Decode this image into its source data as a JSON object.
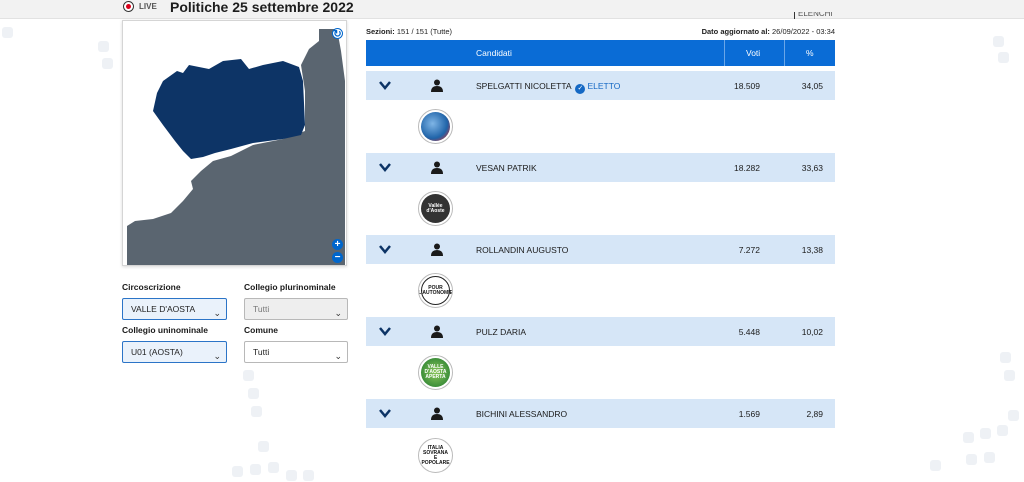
{
  "header": {
    "live_label": "LIVE",
    "title": "Politiche 25 settembre 2022",
    "partial_right_text": "ELENCHI"
  },
  "filters": {
    "circoscrizione": {
      "label": "Circoscrizione",
      "value": "VALLE D'AOSTA"
    },
    "collegio_plurinominale": {
      "label": "Collegio plurinominale",
      "value": "Tutti"
    },
    "collegio_uninominale": {
      "label": "Collegio uninominale",
      "value": "U01 (AOSTA)"
    },
    "comune": {
      "label": "Comune",
      "value": "Tutti"
    }
  },
  "meta": {
    "sezioni_label": "Sezioni:",
    "sezioni_value": "151 / 151 (Tutte)",
    "updated_label": "Dato aggiornato al:",
    "updated_value": "26/09/2022 - 03:34"
  },
  "table": {
    "headers": {
      "candidati": "Candidati",
      "voti": "Voti",
      "percent": "%"
    },
    "rows": [
      {
        "name": "SPELGATTI NICOLETTA",
        "elected": "ELETTO",
        "votes": "18.509",
        "pct": "34,05",
        "logo_color": "#1f63a8"
      },
      {
        "name": "VESAN PATRIK",
        "elected": "",
        "votes": "18.282",
        "pct": "33,63",
        "logo_color": "#333333"
      },
      {
        "name": "ROLLANDIN AUGUSTO",
        "elected": "",
        "votes": "7.272",
        "pct": "13,38",
        "logo_color": "#ffffff"
      },
      {
        "name": "PULZ DARIA",
        "elected": "",
        "votes": "5.448",
        "pct": "10,02",
        "logo_color": "#3d8f3a"
      },
      {
        "name": "BICHINI ALESSANDRO",
        "elected": "",
        "votes": "1.569",
        "pct": "2,89",
        "logo_color": "#ffffff"
      }
    ],
    "logo_texts": [
      "",
      "Vallée d'Aoste",
      "POUR L'AUTONOMIE",
      "VALLE D'AOSTA APERTA",
      "ITALIA SOVRANA E POPOLARE"
    ]
  },
  "map": {
    "selected_color": "#0d3466",
    "other_color": "#5a6570",
    "icons": [
      "refresh-icon",
      "zoom-in-icon",
      "zoom-out-icon"
    ]
  }
}
